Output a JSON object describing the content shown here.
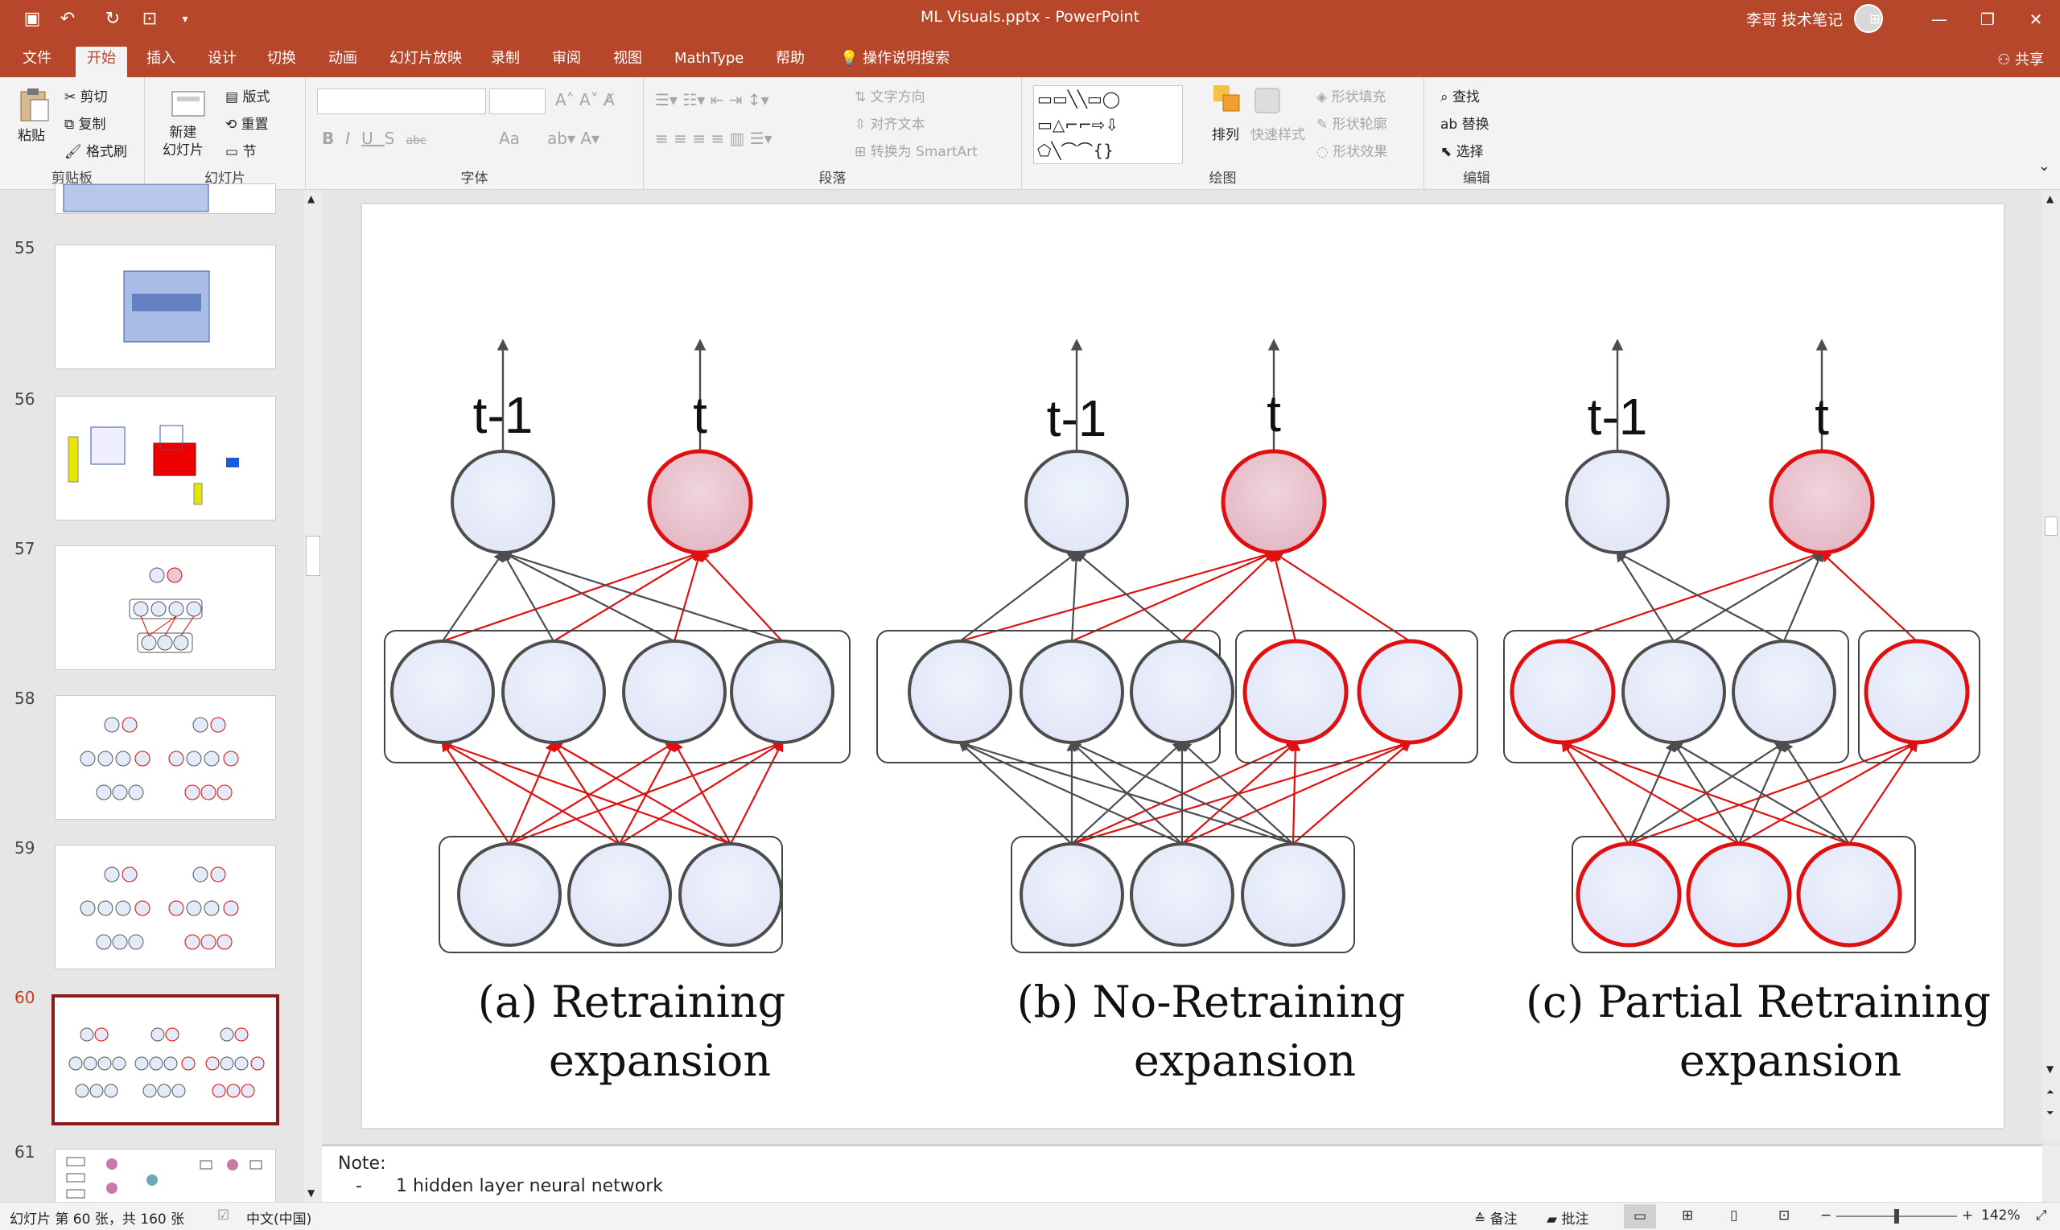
{
  "window": {
    "title": "ML Visuals.pptx  -  PowerPoint",
    "user": "李哥 技术笔记",
    "minimize": "—",
    "restore": "❐",
    "close": "✕"
  },
  "tabs": [
    "文件",
    "开始",
    "插入",
    "设计",
    "切换",
    "动画",
    "幻灯片放映",
    "录制",
    "审阅",
    "视图",
    "MathType",
    "帮助",
    "操作说明搜索"
  ],
  "active_tab": "开始",
  "share": "共享",
  "ribbon": {
    "clipboard": {
      "paste": "粘贴",
      "cut": "剪切",
      "copy": "复制",
      "format_painter": "格式刷",
      "label": "剪贴板"
    },
    "slides": {
      "new_slide": "新建\n幻灯片",
      "layout": "版式",
      "reset": "重置",
      "section": "节",
      "label": "幻灯片"
    },
    "font": {
      "label": "字体",
      "bold": "B",
      "italic": "I",
      "underline": "U",
      "shadow": "S",
      "strike": "abc",
      "case": "Aa"
    },
    "paragraph": {
      "label": "段落",
      "text_direction": "文字方向",
      "align_text": "对齐文本",
      "smartart": "转换为 SmartArt"
    },
    "drawing": {
      "label": "绘图",
      "arrange": "排列",
      "quick_styles": "快速样式",
      "shape_fill": "形状填充",
      "shape_outline": "形状轮廓",
      "shape_effects": "形状效果"
    },
    "editing": {
      "label": "编辑",
      "find": "查找",
      "replace": "替换",
      "select": "选择"
    }
  },
  "thumbnails": [
    {
      "num": "55"
    },
    {
      "num": "56"
    },
    {
      "num": "57"
    },
    {
      "num": "58"
    },
    {
      "num": "59"
    },
    {
      "num": "60",
      "selected": true
    },
    {
      "num": "61"
    }
  ],
  "slide": {
    "panels": [
      {
        "caption_l1": "(a) Retraining",
        "caption_l2": "expansion",
        "out_left": "t-1",
        "out_right": "t"
      },
      {
        "caption_l1": "(b) No-Retraining",
        "caption_l2": "expansion",
        "out_left": "t-1",
        "out_right": "t"
      },
      {
        "caption_l1": "(c) Partial Retraining",
        "caption_l2": "expansion",
        "out_left": "t-1",
        "out_right": "t"
      }
    ]
  },
  "notes": {
    "heading": "Note:",
    "bullet": "-",
    "item": "1 hidden layer neural network"
  },
  "status": {
    "slide_info": "幻灯片 第 60 张，共 160 张",
    "language": "中文(中国)",
    "notes": "备注",
    "comments": "批注",
    "zoom": "142%"
  },
  "colors": {
    "accent": "#b7472a",
    "red_node": "#e01010",
    "gray_node": "#4d4d4d",
    "node_fill": "#e4ebf8"
  }
}
